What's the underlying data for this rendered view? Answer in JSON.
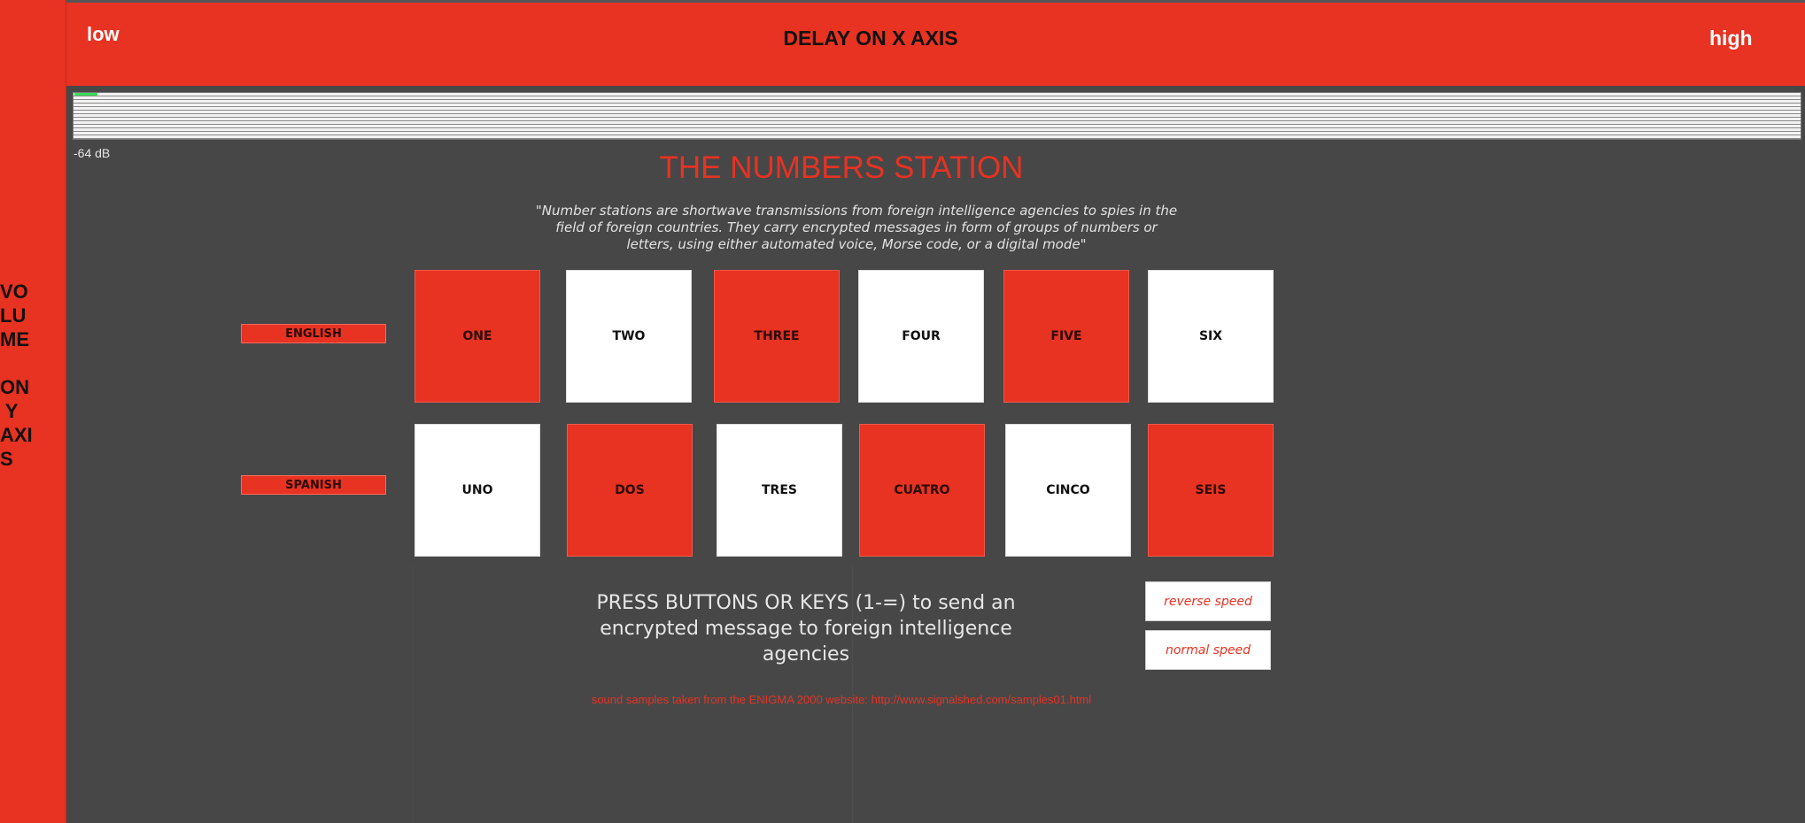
{
  "top_bar": {
    "low_label": "low",
    "title": "DELAY ON X AXIS",
    "high_label": "high"
  },
  "left_bar": {
    "label": "VO\nLU\nME\n\nON\n Y\nAXI\nS"
  },
  "meter": {
    "db_readout": "-64 dB"
  },
  "page": {
    "title": "THE NUMBERS STATION",
    "quote": "\"Number stations are shortwave transmissions from foreign intelligence agencies to spies in the field of foreign countries. They carry encrypted messages in form of groups of numbers or letters, using either automated voice, Morse code, or a digital mode\""
  },
  "languages": {
    "english": "ENGLISH",
    "spanish": "SPANISH"
  },
  "english_numbers": [
    "ONE",
    "TWO",
    "THREE",
    "FOUR",
    "FIVE",
    "SIX"
  ],
  "spanish_numbers": [
    "UNO",
    "DOS",
    "TRES",
    "CUATRO",
    "CINCO",
    "SEIS"
  ],
  "instructions": "PRESS BUTTONS OR KEYS (1-=)  to send an encrypted message to foreign intelligence agencies",
  "controls": {
    "reverse_speed": "reverse speed",
    "normal_speed": "normal speed"
  },
  "credit": "sound samples taken from the ENIGMA 2000 website: http://www.signalshed.com/samples01.html",
  "colors": {
    "accent": "#e83222",
    "background": "#474747",
    "tile_white": "#ffffff"
  }
}
